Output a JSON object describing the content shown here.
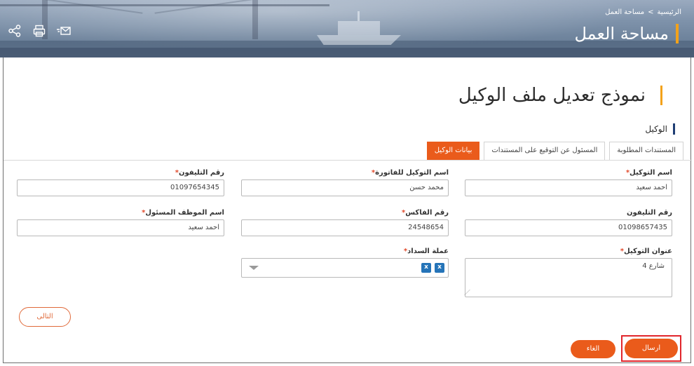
{
  "breadcrumb": {
    "home": "الرئيسية",
    "separator": ">",
    "current": "مساحة العمل"
  },
  "workspace_title": "مساحة العمل",
  "banner_icons": [
    "share-icon",
    "print-icon",
    "email-icon"
  ],
  "form": {
    "title": "نموذج تعديل ملف الوكيل",
    "section_label": "الوكيل",
    "tabs": [
      {
        "label": "بيانات الوكيل",
        "active": true
      },
      {
        "label": "المسئول عن التوقيع على المستندات",
        "active": false
      },
      {
        "label": "المستندات المطلوبة",
        "active": false
      }
    ],
    "required_mark": "*",
    "fields": {
      "agent_name": {
        "label": "اسم التوكيل",
        "required": true,
        "value": "احمد سعيد"
      },
      "invoice_agency_name": {
        "label": "اسم التوكيل للفاتورة",
        "required": true,
        "value": "محمد حسن"
      },
      "phone_1": {
        "label": "رقم التليفون",
        "required": true,
        "value": "01097654345"
      },
      "phone_2": {
        "label": "رقم التليفون",
        "required": false,
        "value": "01098657435"
      },
      "fax": {
        "label": "رقم الفاكس",
        "required": true,
        "value": "24548654"
      },
      "responsible_employee": {
        "label": "اسم الموظف المسئول",
        "required": true,
        "value": "احمد سعيد"
      },
      "agency_address": {
        "label": "عنوان التوكيل",
        "required": true,
        "value": "شارع 4"
      },
      "payment_currency": {
        "label": "عملة السداد",
        "required": true,
        "tags": [
          "x",
          "x"
        ]
      }
    }
  },
  "buttons": {
    "next": "التالى",
    "send": "ارسال",
    "cancel": "الغاء"
  },
  "colors": {
    "accent": "#ea5b1b",
    "title_bar": "#f3a21a",
    "section_bar": "#1f3e74",
    "tag": "#2574b8",
    "highlight": "#e1262c"
  }
}
